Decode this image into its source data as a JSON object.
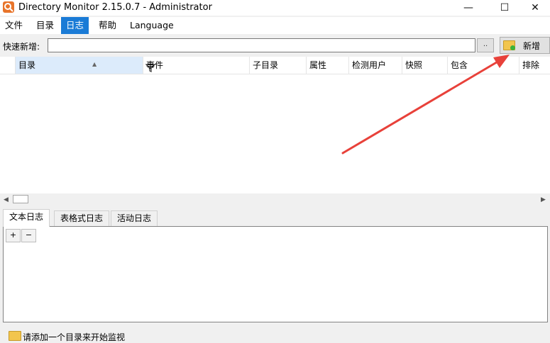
{
  "window": {
    "title": "Directory Monitor 2.15.0.7 - Administrator",
    "icon": "app-logo-icon",
    "controls": {
      "minimize": "—",
      "maximize": "☐",
      "close": "✕"
    }
  },
  "menu": {
    "items": [
      {
        "label": "文件",
        "active": false
      },
      {
        "label": "目录",
        "active": false
      },
      {
        "label": "日志",
        "active": true
      },
      {
        "label": "帮助",
        "active": false
      },
      {
        "label": "Language",
        "active": false
      }
    ]
  },
  "quick_add": {
    "label": "快速新增:",
    "input_value": "",
    "browse_label": "..",
    "add_label": "新增",
    "add_icon": "folder-add-icon"
  },
  "table": {
    "columns": [
      "目录",
      "事件",
      "子目录",
      "属性",
      "检测用户",
      "快照",
      "包含",
      "排除"
    ],
    "rows": []
  },
  "log_tabs": {
    "tabs": [
      "文本日志",
      "表格式日志",
      "活动日志"
    ],
    "active_index": 0,
    "toolbar": {
      "expand": "+",
      "collapse": "−"
    }
  },
  "status": {
    "text": "请添加一个目录来开始监视",
    "icon": "folder-icon"
  },
  "colors": {
    "menu_active": "#1a7bd6",
    "header_selected": "#dcebfb",
    "annotation_arrow": "#e8413a",
    "app_icon": "#e8742a"
  }
}
